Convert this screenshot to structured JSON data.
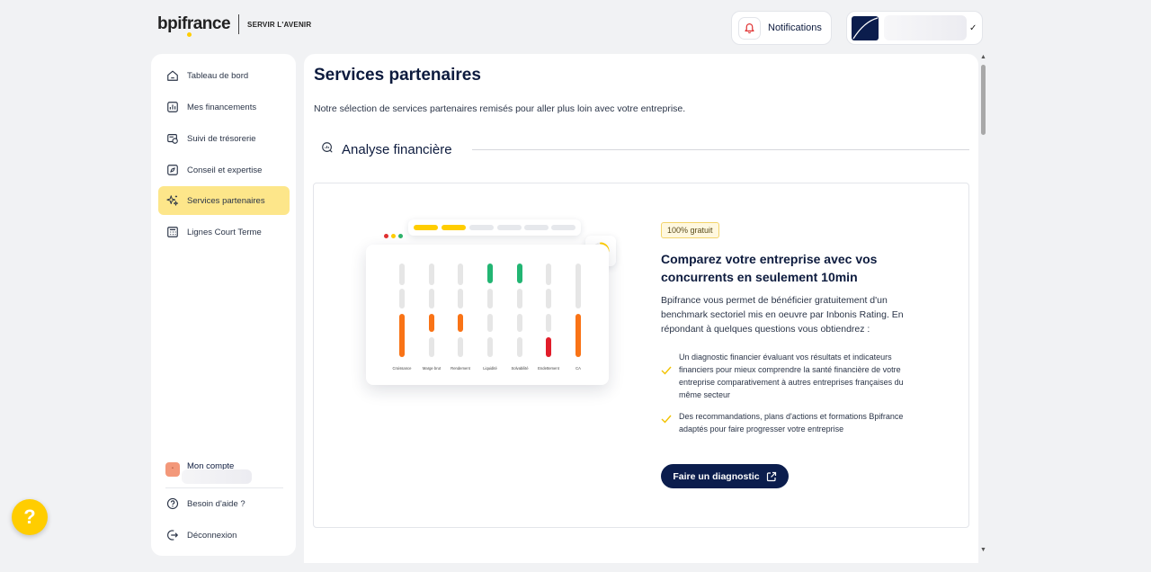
{
  "brand": {
    "name": "bpifrance",
    "tagline": "SERVIR L'AVENIR",
    "accent": "#ffcd00"
  },
  "header": {
    "notifications_label": "Notifications"
  },
  "sidebar": {
    "items": [
      {
        "label": "Tableau de bord",
        "icon": "home-icon"
      },
      {
        "label": "Mes financements",
        "icon": "chart-icon"
      },
      {
        "label": "Suivi de trésorerie",
        "icon": "treasury-icon"
      },
      {
        "label": "Conseil et expertise",
        "icon": "compass-icon"
      },
      {
        "label": "Services partenaires",
        "icon": "sparkle-icon",
        "active": true
      },
      {
        "label": "Lignes Court Terme",
        "icon": "calculator-icon"
      }
    ],
    "account_label": "Mon compte",
    "help_label": "Besoin d'aide ?",
    "logout_label": "Déconnexion"
  },
  "main": {
    "title": "Services partenaires",
    "subtitle": "Notre sélection de services partenaires remisés pour aller plus loin avec votre entreprise.",
    "section_title": "Analyse financière",
    "card": {
      "badge": "100% gratuit",
      "title": "Comparez votre entreprise avec vos concurrents en seulement 10min",
      "description": "Bpifrance vous permet de bénéficier gratuitement d'un benchmark sectoriel mis en oeuvre par Inbonis Rating. En répondant à quelques questions vous obtiendrez :",
      "bullets": [
        "Un diagnostic financier évaluant vos résultats et indicateurs financiers pour mieux comprendre la santé financière de votre entreprise comparativement à autres entreprises françaises du même secteur",
        "Des recommandations, plans d'actions et formations Bpifrance adaptés pour faire progresser votre entreprise"
      ],
      "cta_label": "Faire un diagnostic",
      "illustration_labels": [
        "Croissance",
        "Marge brut",
        "Rendement",
        "Liquidité",
        "Solvabilité",
        "Endettement",
        "CA"
      ]
    }
  },
  "help_fab_label": "?"
}
